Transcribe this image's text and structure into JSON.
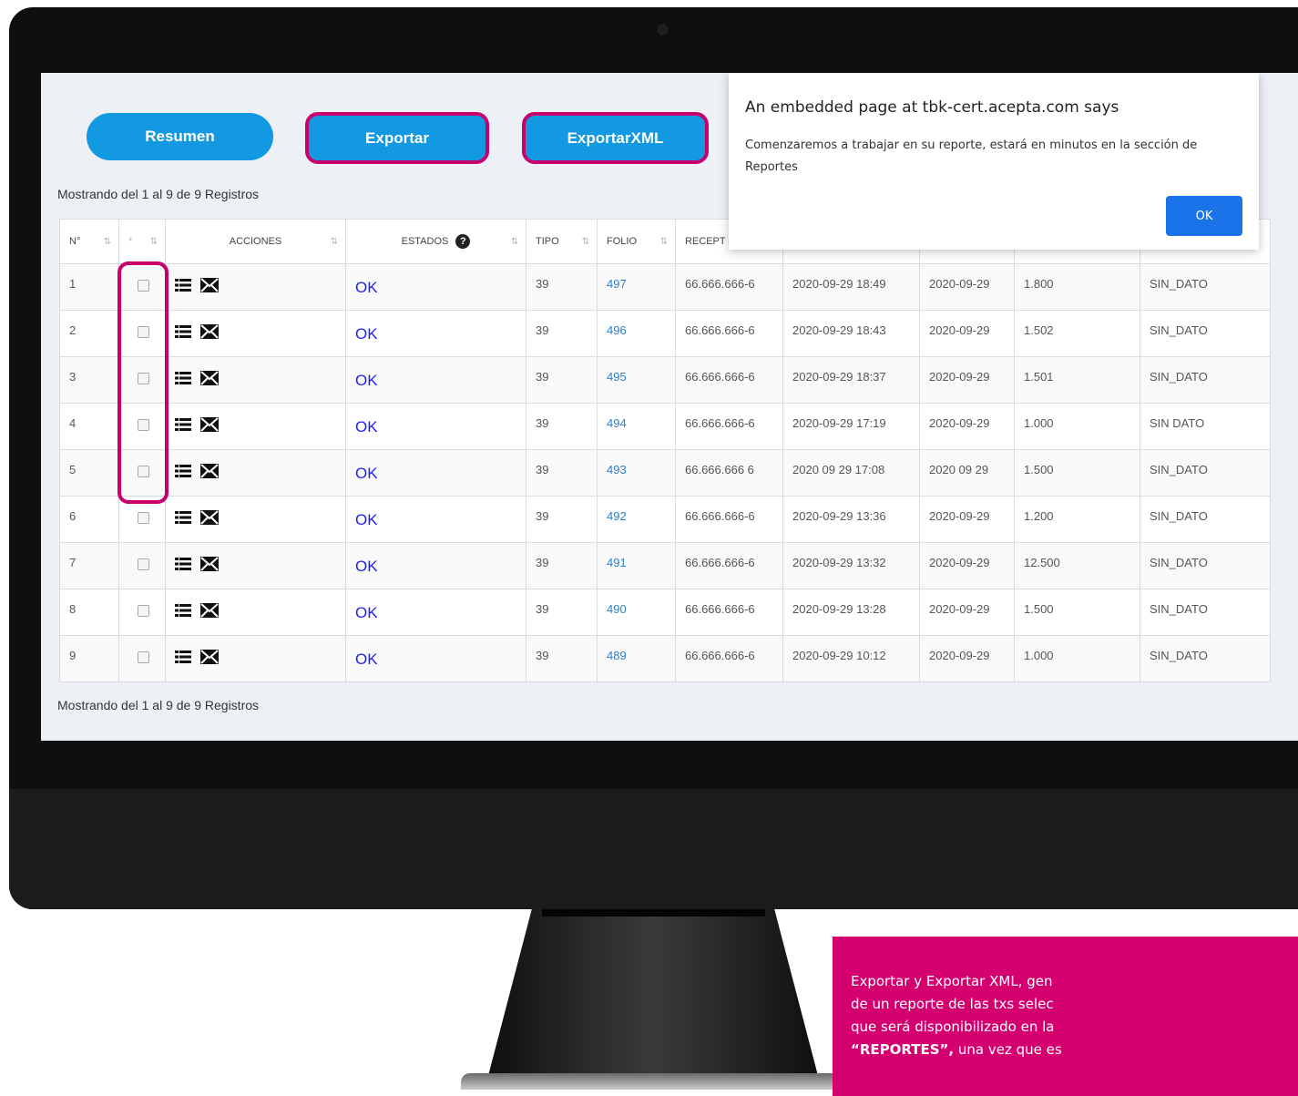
{
  "buttons": {
    "resumen": "Resumen",
    "exportar": "Exportar",
    "exportar_xml": "ExportarXML"
  },
  "info_top": "Mostrando del 1 al 9 de 9 Registros",
  "info_bottom": "Mostrando del 1 al 9 de 9 Registros",
  "table": {
    "headers": [
      "N°",
      "*",
      "ACCIONES",
      "ESTADOS",
      "TIPO",
      "FOLIO",
      "RECEPT"
    ],
    "help_icon": "?",
    "rows": [
      {
        "n": "1",
        "estado": "OK",
        "tipo": "39",
        "folio": "497",
        "receptor": "66.666.666-6",
        "fecha": "2020-09-29 18:49",
        "fecha2": "2020-09-29",
        "monto": "1.800",
        "dato": "SIN_DATO"
      },
      {
        "n": "2",
        "estado": "OK",
        "tipo": "39",
        "folio": "496",
        "receptor": "66.666.666-6",
        "fecha": "2020-09-29 18:43",
        "fecha2": "2020-09-29",
        "monto": "1.502",
        "dato": "SIN_DATO"
      },
      {
        "n": "3",
        "estado": "OK",
        "tipo": "39",
        "folio": "495",
        "receptor": "66.666.666-6",
        "fecha": "2020-09-29 18:37",
        "fecha2": "2020-09-29",
        "monto": "1.501",
        "dato": "SIN_DATO"
      },
      {
        "n": "4",
        "estado": "OK",
        "tipo": "39",
        "folio": "494",
        "receptor": "66.666.666-6",
        "fecha": "2020-09-29 17:19",
        "fecha2": "2020-09-29",
        "monto": "1.000",
        "dato": "SIN DATO"
      },
      {
        "n": "5",
        "estado": "OK",
        "tipo": "39",
        "folio": "493",
        "receptor": "66.666.666 6",
        "fecha": "2020 09 29 17:08",
        "fecha2": "2020 09 29",
        "monto": "1.500",
        "dato": "SIN_DATO"
      },
      {
        "n": "6",
        "estado": "OK",
        "tipo": "39",
        "folio": "492",
        "receptor": "66.666.666-6",
        "fecha": "2020-09-29 13:36",
        "fecha2": "2020-09-29",
        "monto": "1.200",
        "dato": "SIN_DATO"
      },
      {
        "n": "7",
        "estado": "OK",
        "tipo": "39",
        "folio": "491",
        "receptor": "66.666.666-6",
        "fecha": "2020-09-29 13:32",
        "fecha2": "2020-09-29",
        "monto": "12.500",
        "dato": "SIN_DATO"
      },
      {
        "n": "8",
        "estado": "OK",
        "tipo": "39",
        "folio": "490",
        "receptor": "66.666.666-6",
        "fecha": "2020-09-29 13:28",
        "fecha2": "2020-09-29",
        "monto": "1.500",
        "dato": "SIN_DATO"
      },
      {
        "n": "9",
        "estado": "OK",
        "tipo": "39",
        "folio": "489",
        "receptor": "66.666.666-6",
        "fecha": "2020-09-29 10:12",
        "fecha2": "2020-09-29",
        "monto": "1.000",
        "dato": "SIN_DATO"
      }
    ]
  },
  "dialog": {
    "title": "An embedded page at tbk-cert.acepta.com says",
    "message": "Comenzaremos a trabajar en su reporte, estará en minutos en la sección de Reportes",
    "ok": "OK"
  },
  "callout": {
    "line1": "Exportar y Exportar XML, gen",
    "line2": "de un reporte de las txs selec",
    "line3": "que será disponibilizado en la",
    "line4_bold": "“REPORTES”,",
    "line4_rest": " una vez que es"
  },
  "colors": {
    "accent": "#1398e2",
    "highlight": "#c8006e",
    "callout_bg": "#d5006f",
    "ok_text": "#1f1ff2"
  }
}
